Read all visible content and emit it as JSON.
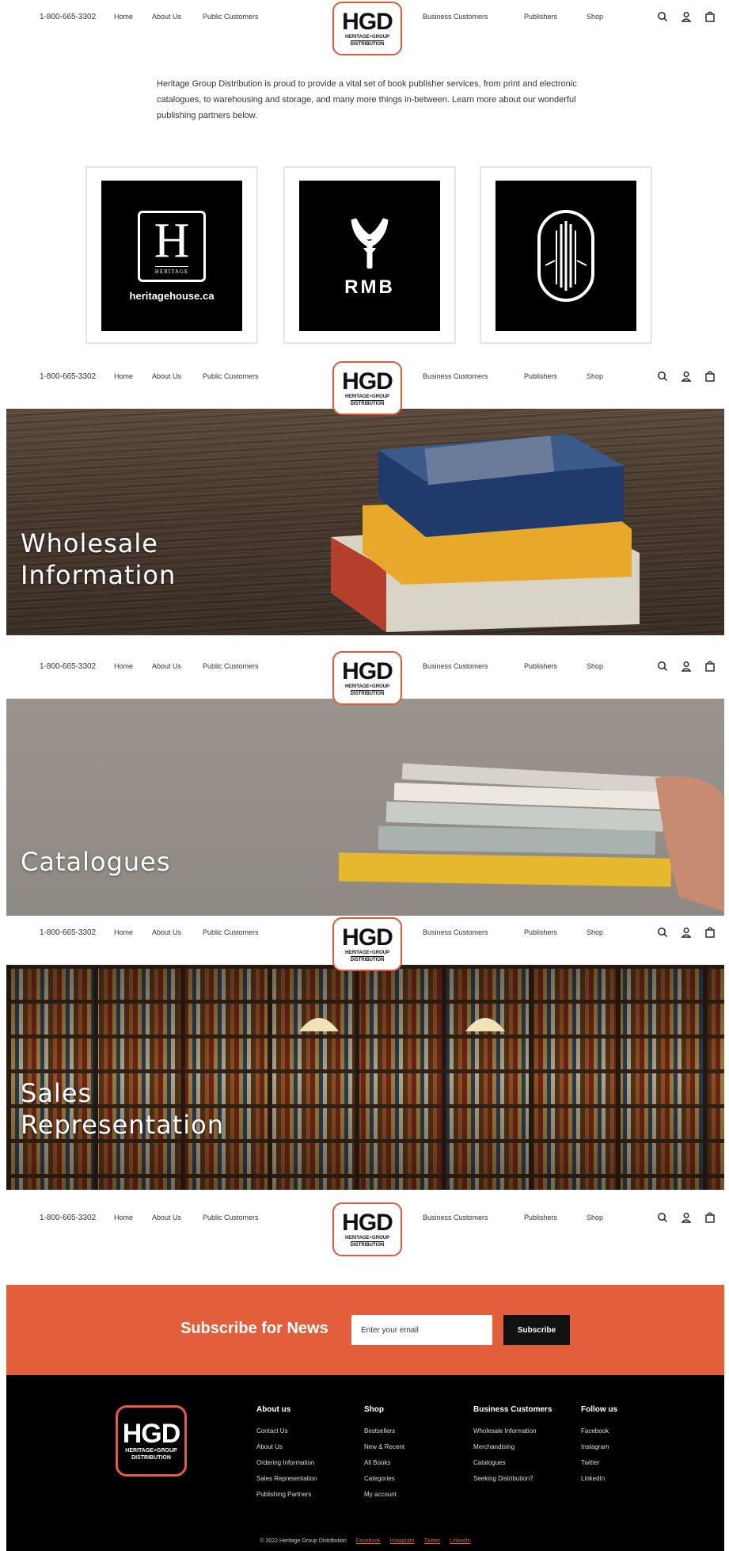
{
  "header": {
    "phone": "1-800-665-3302",
    "nav": [
      "Home",
      "About Us",
      "Public Customers",
      "Business Customers",
      "Publishers",
      "Shop"
    ],
    "logo": {
      "big": "HGD",
      "line1": "HERITAGE+GROUP",
      "line2": "DISTRIBUTION"
    },
    "icons": [
      "search-icon",
      "account-icon",
      "cart-icon"
    ]
  },
  "intro": {
    "text": "Heritage Group Distribution is proud to provide a vital set of book publisher services, from print and electronic catalogues, to warehousing and storage, and many more things in-between. Learn more about our wonderful publishing partners below."
  },
  "publishers": [
    {
      "logo_letter": "H",
      "logo_sub": "HERITAGE",
      "label": "heritagehouse.ca"
    },
    {
      "label": "RMB"
    },
    {
      "label": ""
    }
  ],
  "banners": [
    {
      "title_line1": "Wholesale",
      "title_line2": "Information"
    },
    {
      "title_line1": "Catalogues",
      "title_line2": ""
    },
    {
      "title_line1": "Sales",
      "title_line2": "Representation"
    }
  ],
  "subscribe": {
    "label": "Subscribe for News",
    "placeholder": "Enter your email",
    "button": "Subscribe"
  },
  "footer": {
    "logo": {
      "big": "HGD",
      "line1": "HERITAGE+GROUP",
      "line2": "DISTRIBUTION"
    },
    "columns": [
      {
        "heading": "About us",
        "links": [
          "Contact Us",
          "About Us",
          "Ordering Information",
          "Sales Representation",
          "Publishing Partners"
        ]
      },
      {
        "heading": "Shop",
        "links": [
          "Bestsellers",
          "New & Recent",
          "All Books",
          "Categories",
          "My account"
        ]
      },
      {
        "heading": "Business Customers",
        "links": [
          "Wholesale Information",
          "Merchandising",
          "Catalogues",
          "Seeking Distribution?"
        ]
      },
      {
        "heading": "Follow us",
        "links": [
          "Facebook",
          "Instagram",
          "Twitter",
          "LinkedIn"
        ]
      }
    ],
    "copyright": "© 2022 Heritage Group Distribution",
    "social": [
      "Facebook",
      "Instagram",
      "Twitter",
      "LinkedIn"
    ]
  },
  "colors": {
    "accent": "#e35f3b",
    "footer_bg": "#000000"
  }
}
